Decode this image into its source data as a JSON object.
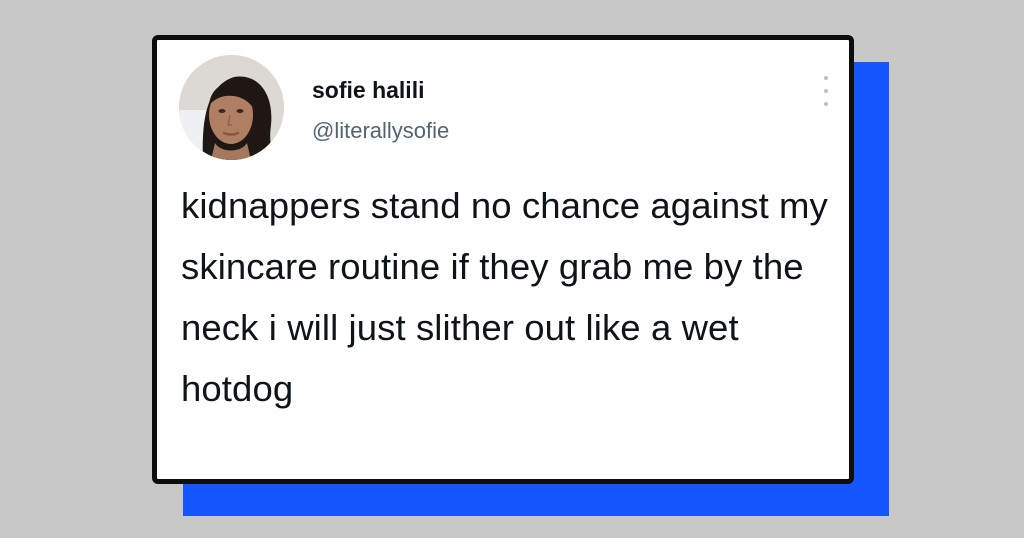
{
  "tweet": {
    "display_name": "sofie halili",
    "handle": "@literallysofie",
    "text": "kidnappers stand no chance against my skincare routine if they grab me by the neck i will just slither out like a wet hotdog",
    "more_icon": "more-vertical-icon",
    "avatar_icon": "profile-photo"
  },
  "colors": {
    "background": "#c8c8c8",
    "accent_shadow": "#1456ff",
    "card_border": "#0d0d0d",
    "text_primary": "#0f1419",
    "text_secondary": "#536471"
  }
}
